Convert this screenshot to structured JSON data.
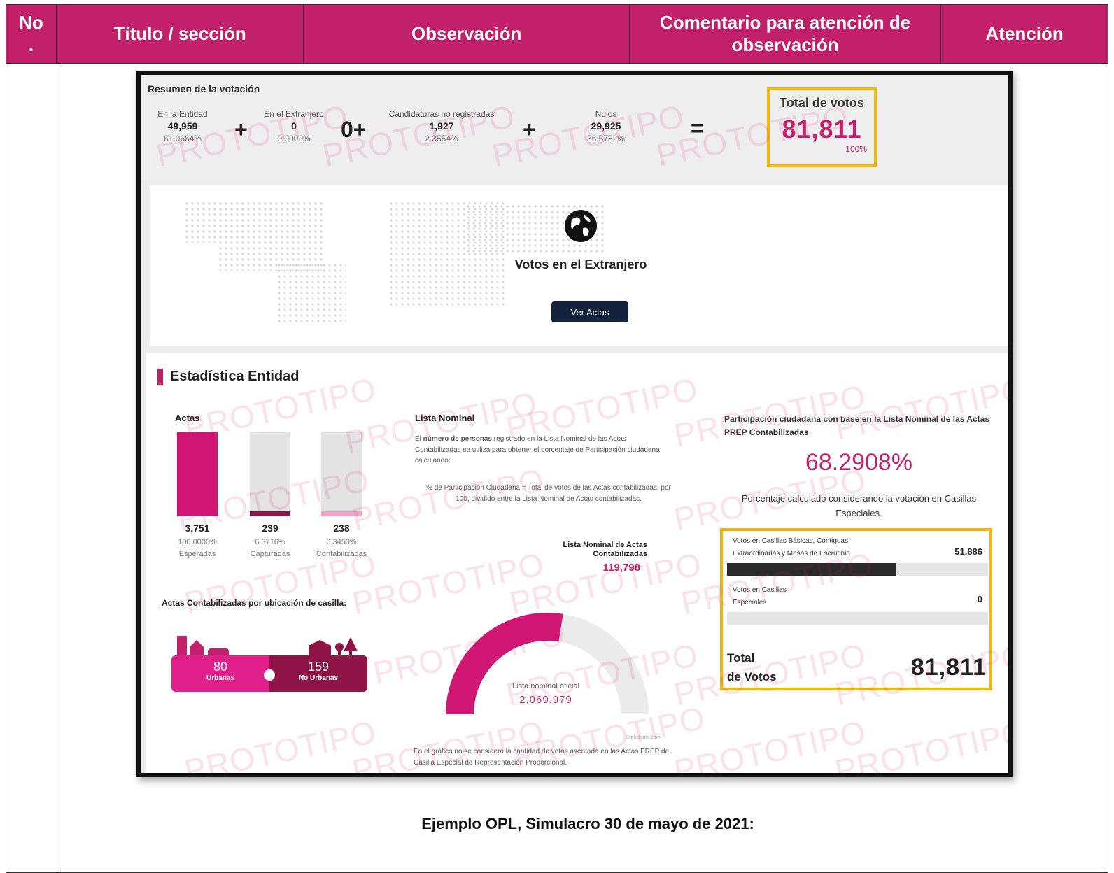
{
  "table": {
    "headers": {
      "no_line1": "No",
      "no_line2": ".",
      "titulo": "Título / sección",
      "observacion": "Observación",
      "comentario": "Comentario para atención de observación",
      "atencion": "Atención"
    }
  },
  "screenshot": {
    "watermark": "PROTOTIPO",
    "resumen": {
      "title": "Resumen de la votación",
      "entidad": {
        "label": "En la Entidad",
        "value": "49,959",
        "pct": "61.0664%"
      },
      "extranjero": {
        "label": "En el Extranjero",
        "value": "0",
        "pct": "0.0000%"
      },
      "no_registradas": {
        "label": "Candidaturas no registradas",
        "value": "1,927",
        "pct": "2.3554%"
      },
      "nulos": {
        "label": "Nulos",
        "value": "29,925",
        "pct": "36.5782%"
      },
      "op_plus": "+",
      "op_zero_plus": "0+",
      "op_equals": "=",
      "total": {
        "label": "Total de votos",
        "value": "81,811",
        "pct": "100%"
      }
    },
    "extranjero": {
      "title": "Votos en el Extranjero",
      "button": "Ver Actas"
    },
    "estadistica": {
      "title": "Estadística Entidad",
      "actas_label": "Actas",
      "bars": [
        {
          "value": "3,751",
          "pct": "100.0000%",
          "label": "Esperadas",
          "fill": 1.0,
          "color": "#d01673"
        },
        {
          "value": "239",
          "pct": "6.3716%",
          "label": "Capturadas",
          "fill": 0.06,
          "color": "#8e1546"
        },
        {
          "value": "238",
          "pct": "6.3450%",
          "label": "Contabilizadas",
          "fill": 0.06,
          "color": "#f3a3c8"
        }
      ],
      "ubicacion": {
        "title": "Actas Contabilizadas por ubicación de casilla:",
        "urbanas_value": "80",
        "urbanas_label": "Urbanas",
        "no_urbanas_value": "159",
        "no_urbanas_label": "No Urbanas"
      },
      "lista": {
        "title": "Lista Nominal",
        "p1_a": "El ",
        "p1_bold": "número de personas",
        "p1_b": " registrado en la Lista Nominal de las Actas Contabilizadas se utiliza para obtener el porcentaje de Participación ciudadana calculando:",
        "p2": "% de Participación Ciudadana = Total de votos de las Actas contabilizadas, por 100, dividido entre la Lista Nominal de Actas contabilizadas.",
        "contabilizadas_label": "Lista Nominal de Actas Contabilizadas",
        "contabilizadas_value": "119,798",
        "oficial_label": "Lista nominal oficial",
        "oficial_value": "2,069,979",
        "gauge_fraction": 0.55,
        "credit": "Highcharts.com",
        "note": "En el gráfico no se considera la cantidad de votos asentada en las Actas PREP de Casilla Especial de Representación Proporcional."
      },
      "participacion": {
        "title": "Participación ciudadana con base en la Lista Nominal de las Actas PREP Contabilizadas",
        "pct": "68.2908%",
        "note": "Porcentaje calculado considerando la votación en Casillas Especiales.",
        "basicas_label": "Votos en Casillas Básicas, Contiguas, Extraordinarias y Mesas de Escrutinio",
        "basicas_value": "51,886",
        "basicas_fill": 0.65,
        "especiales_label": "Votos en Casillas Especiales",
        "especiales_value": "0",
        "especiales_fill": 0.0,
        "total_label_1": "Total",
        "total_label_2": "de Votos",
        "total_value": "81,811"
      }
    }
  },
  "caption": "Ejemplo OPL, Simulacro 30 de mayo de 2021:"
}
